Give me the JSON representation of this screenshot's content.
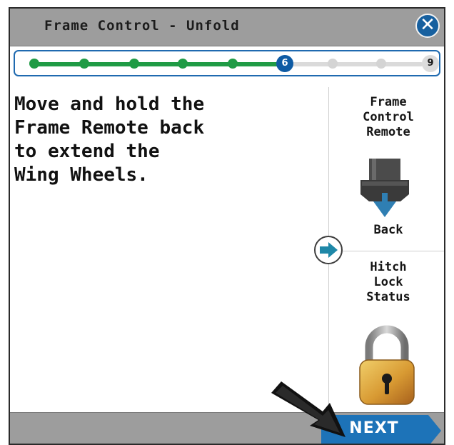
{
  "header": {
    "title": "Frame Control - Unfold",
    "close_icon": "close-icon"
  },
  "progress": {
    "current_step": "6",
    "total_steps": "9",
    "completed_fraction": 0.625
  },
  "instruction": "Move and hold the\nFrame Remote back\nto extend the\nWing Wheels.",
  "side_panel": {
    "remote_title": "Frame\nControl\nRemote",
    "remote_direction": "Back",
    "hitch_title": "Hitch\nLock\nStatus",
    "hitch_state_icon": "padlock-locked-icon"
  },
  "footer": {
    "next_label": "NEXT"
  },
  "colors": {
    "titlebar": "#9d9d9d",
    "progress_done": "#1f9b45",
    "accent_blue": "#17609f",
    "arrow_teal": "#1f88a8"
  }
}
